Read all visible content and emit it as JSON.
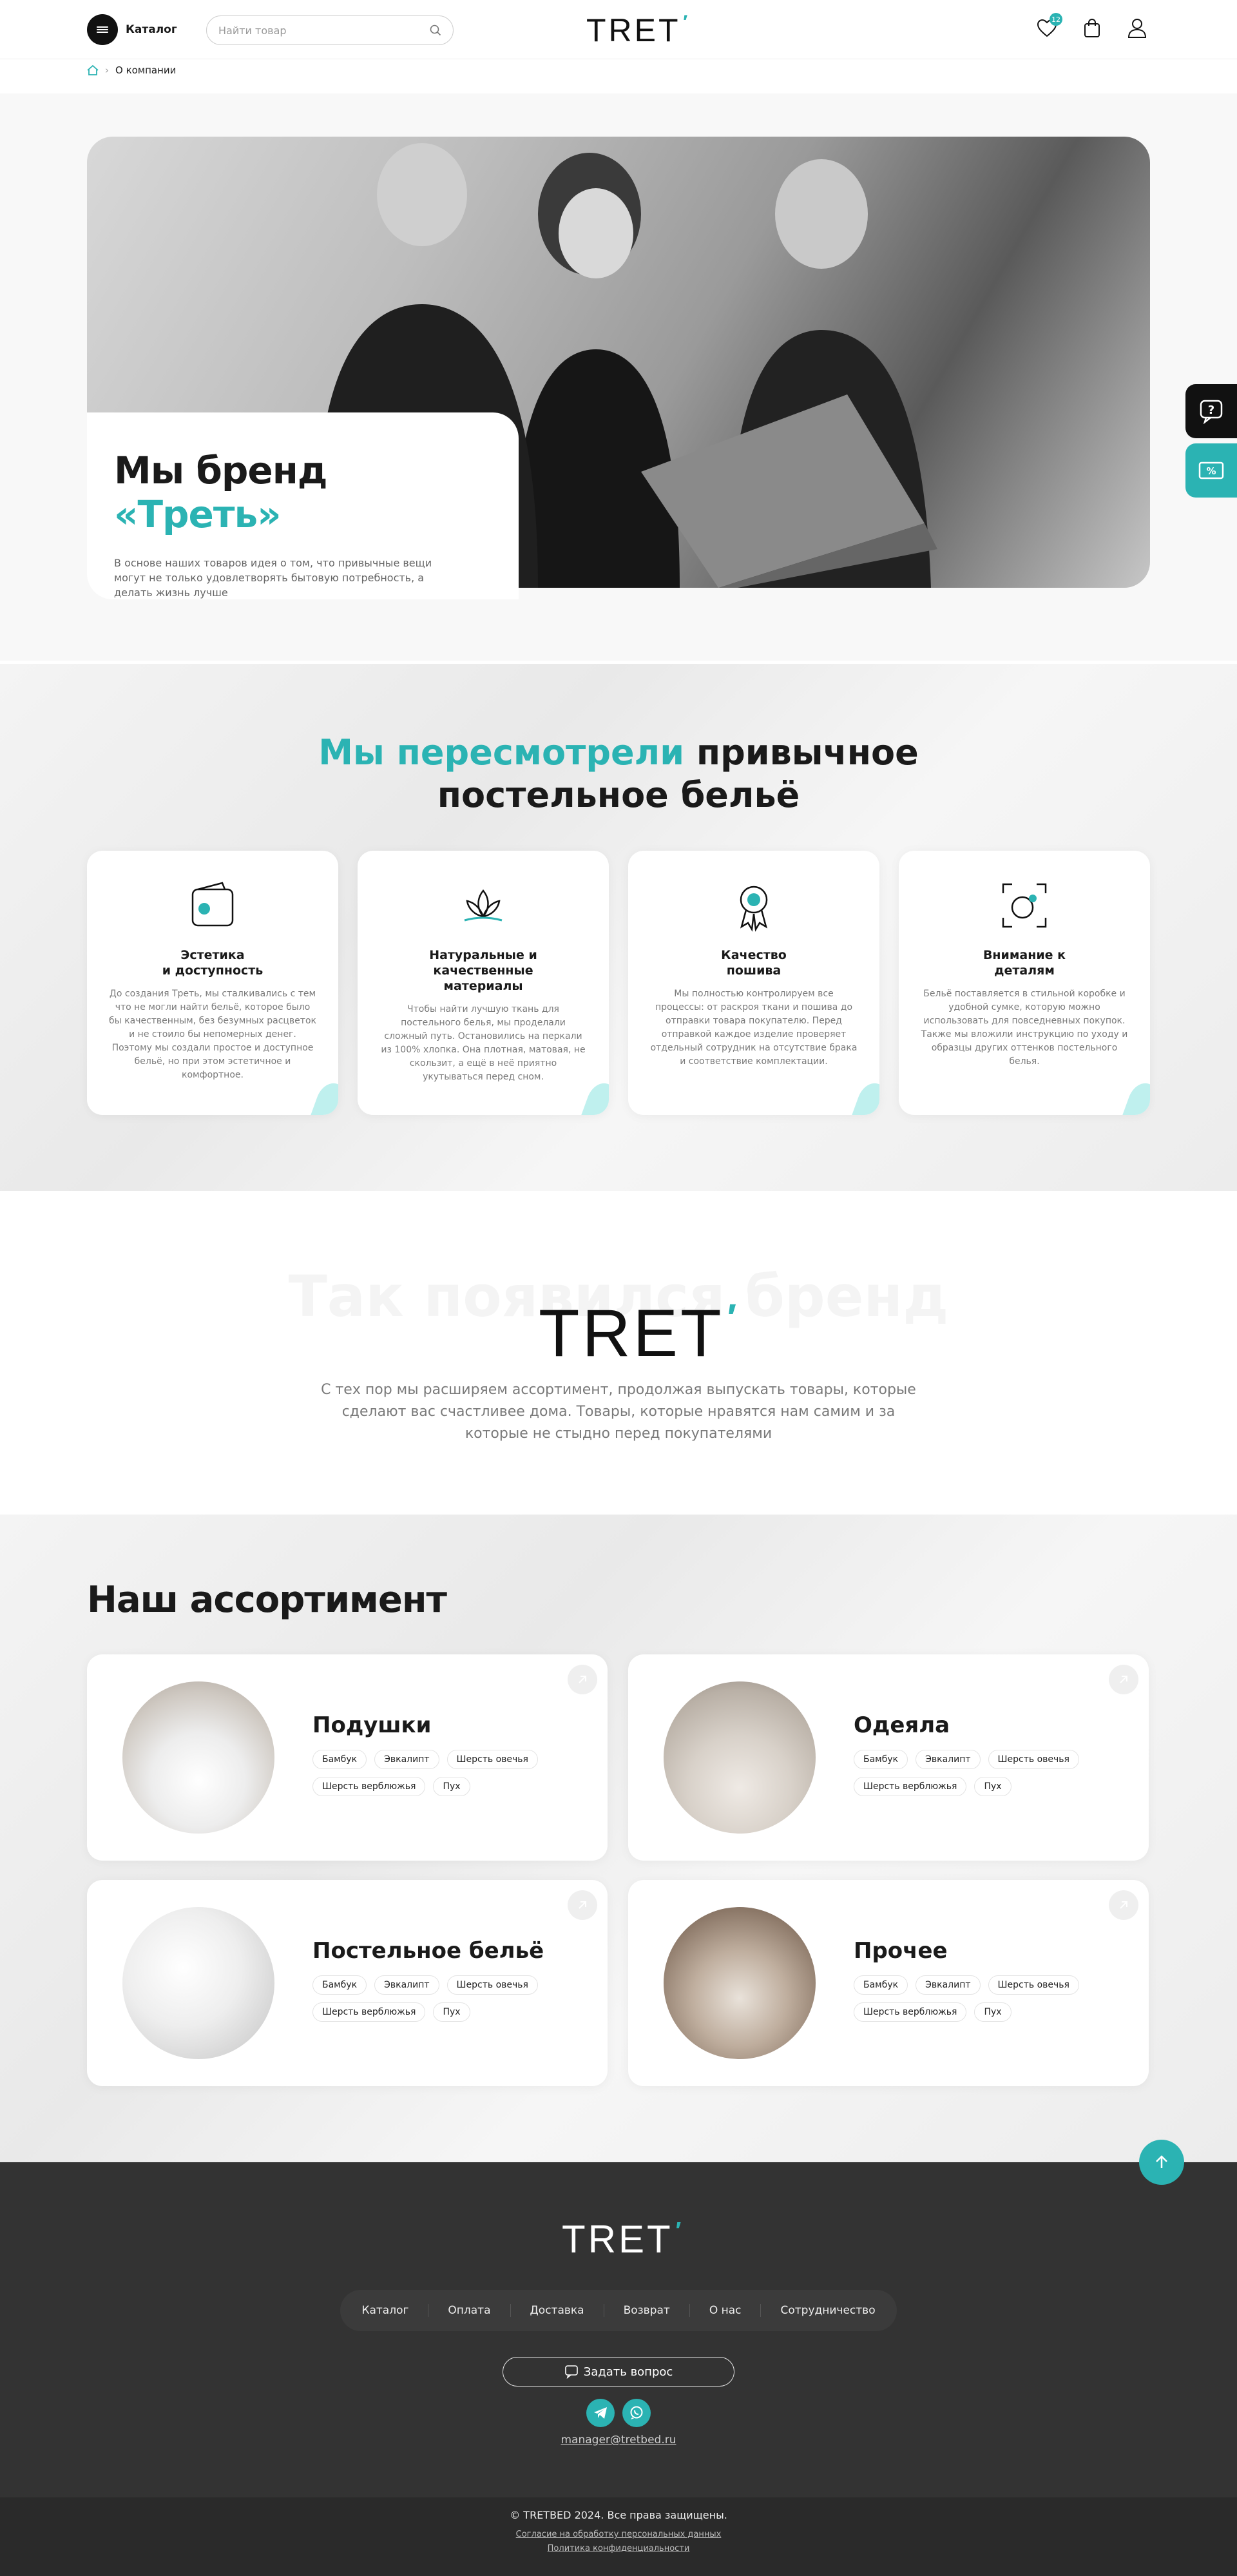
{
  "header": {
    "catalog_label": "Каталог",
    "search_placeholder": "Найти товар",
    "logo_text": "TRET",
    "favorites_count": "12"
  },
  "breadcrumbs": {
    "current": "О компании"
  },
  "hero": {
    "title_plain": "Мы бренд ",
    "title_accent": "«Треть»",
    "text": "В основе наших товаров идея о том, что привычные вещи могут не только удовлетворять бытовую потребность, а делать жизнь лучше"
  },
  "section2": {
    "title_accent": "Мы пересмотрели",
    "title_plain": " привычное",
    "title_line2": "постельное бельё",
    "features": [
      {
        "icon": "wallet-icon",
        "title": "Эстетика\nи доступность",
        "text": "До создания Треть, мы сталкивались с тем что не могли найти бельё, которое было бы качественным, без безумных расцветок и не стоило бы непомерных денег. Поэтому мы создали простое и доступное бельё, но при этом эстетичное и комфортное."
      },
      {
        "icon": "lotus-icon",
        "title": "Натуральные и качественные\nматериалы",
        "text": "Чтобы найти лучшую ткань для постельного белья, мы проделали сложный путь. Остановились на перкали из 100% хлопка. Она плотная, матовая, не скользит, а ещё в неё приятно укутываться перед сном."
      },
      {
        "icon": "award-icon",
        "title": "Качество\nпошива",
        "text": "Мы полностью контролируем все процессы: от раскроя ткани и пошива до отправки товара покупателю. Перед отправкой каждое изделие проверяет отдельный сотрудник на отсутствие брака и соответствие комплектации."
      },
      {
        "icon": "focus-icon",
        "title": "Внимание к\nдеталям",
        "text": "Бельё поставляется в стильной коробке и удобной сумке, которую можно использовать для повседневных покупок. Также мы вложили инструкцию по уходу и образцы других оттенков постельного белья."
      }
    ]
  },
  "section3": {
    "ghost_title": "Так появился бренд",
    "logo_text": "TRET",
    "text": "С тех пор мы расширяем ассортимент, продолжая выпускать товары, которые сделают вас счастливее дома. Товары, которые нравятся нам самим и за которые не стыдно перед покупателями"
  },
  "assortment": {
    "title": "Наш ассортимент",
    "categories": [
      {
        "name": "Подушки",
        "tags": [
          "Бамбук",
          "Эвкалипт",
          "Шерсть овечья",
          "Шерсть верблюжья",
          "Пух"
        ]
      },
      {
        "name": "Одеяла",
        "tags": [
          "Бамбук",
          "Эвкалипт",
          "Шерсть овечья",
          "Шерсть верблюжья",
          "Пух"
        ]
      },
      {
        "name": "Постельное бельё",
        "tags": [
          "Бамбук",
          "Эвкалипт",
          "Шерсть овечья",
          "Шерсть верблюжья",
          "Пух"
        ]
      },
      {
        "name": "Прочее",
        "tags": [
          "Бамбук",
          "Эвкалипт",
          "Шерсть овечья",
          "Шерсть верблюжья",
          "Пух"
        ]
      }
    ]
  },
  "footer": {
    "logo_text": "TRET",
    "nav": [
      "Каталог",
      "Оплата",
      "Доставка",
      "Возврат",
      "О нас",
      "Сотрудничество"
    ],
    "ask_label": "Задать вопрос",
    "email": "manager@tretbed.ru",
    "copyright": "© TRETBED 2024. Все права защищены.",
    "consent": "Согласие на обработку персональных данных",
    "privacy": "Политика конфиденциальности"
  },
  "colors": {
    "accent": "#2bb3b3",
    "dark": "#111111",
    "footer": "#333333"
  }
}
